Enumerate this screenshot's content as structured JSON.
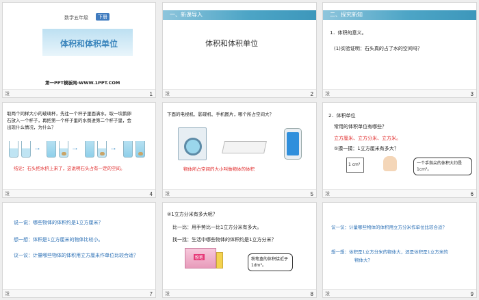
{
  "slides": [
    {
      "number": "1",
      "grade": "数学五年级",
      "term_badge": "下册",
      "title": "体积和体积单位",
      "site": "第一PPT模板网-WWW.1PPT.COM"
    },
    {
      "number": "2",
      "section": "一、新课导入",
      "heading": "体积和体积单位"
    },
    {
      "number": "3",
      "section": "二、探究新知",
      "item_title": "1．体积的意义。",
      "q1": "(1)实验证明：石头真的占了水的空间吗？"
    },
    {
      "number": "4",
      "text_lines": [
        "取两个同样大小的玻璃杯，先往一个杯子里面满水，取一块鹅卵",
        "石放入一个杯子，再把第一个杯子里的水倒进第二个杯子里，会",
        "出现什么情况，为什么？"
      ],
      "conclusion": "结论：石头把水挤上来了，这说明石头占有一定的空间。"
    },
    {
      "number": "5",
      "question": "下面的电视机、影碟机、手机图片，哪个所占空间大？",
      "caption": "物体所占空间的大小叫做物体的体积"
    },
    {
      "number": "6",
      "item_title": "2．体积单位",
      "q": "常用的体积单位有哪些？",
      "units": "立方厘米、立方分米、立方米。",
      "sub": "①摸一摸：1立方厘米有多大？",
      "cube_label": "1 cm³",
      "bubble": "一个手指尖的体积大约是1cm³。"
    },
    {
      "number": "7",
      "lines": [
        "说一说：哪些物体的体积约是1立方厘米？",
        "想一想：体积是1立方厘米的物体比较小。",
        "议一议：计量哪些物体的体积用立方厘米作单位比较合适？"
      ]
    },
    {
      "number": "8",
      "title": "②1立方分米有多大呢？",
      "compare": "比一比：用手势比一比1立方分米有多大。",
      "find": "找一找：生活中哪些物体的体积约是1立方分米？",
      "chalk_label": "粉笔",
      "bubble": "粉笔盒的体积接近于1dm³。"
    },
    {
      "number": "9",
      "lines": [
        "议一议：计量哪些物体的体积用立方分米作单位比较合适？",
        "想一想：体积是1立方分米的物体大，还是体积是1立方米的",
        "物体大？"
      ]
    }
  ],
  "footer_mark": "泼"
}
